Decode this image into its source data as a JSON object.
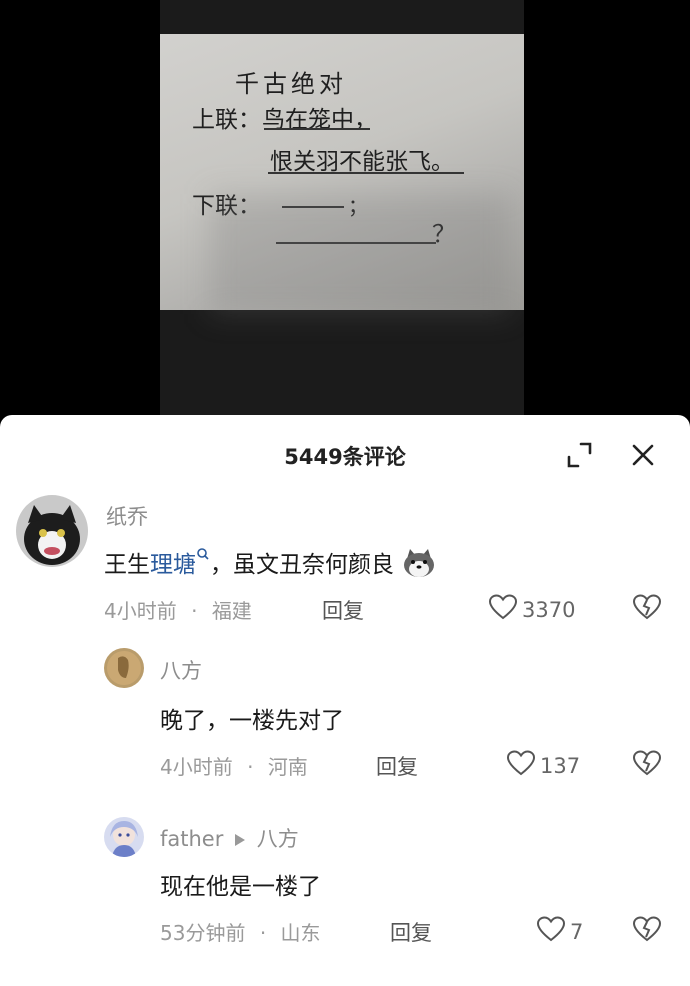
{
  "video": {
    "lines": {
      "title": "千古绝对",
      "upper_label": "上联：",
      "upper_1": "鸟在笼中，",
      "upper_2": "恨关羽不能张飞。",
      "lower_label": "下联：",
      "blank_1_end": "；",
      "blank_2_end": "？"
    }
  },
  "header": {
    "title": "5449条评论",
    "shrink_icon": "shrink-icon",
    "close_icon": "close-icon"
  },
  "comments": [
    {
      "user": "纸乔",
      "text_pre": "王生",
      "link": "理塘",
      "text_post": "，虽文丑奈何颜良",
      "time": "4小时前",
      "location": "福建",
      "reply": "回复",
      "likes": "3370"
    },
    {
      "user": "八方",
      "text": "晚了，一楼先对了",
      "time": "4小时前",
      "location": "河南",
      "reply": "回复",
      "likes": "137"
    },
    {
      "user": "father",
      "reply_to": "八方",
      "text": "现在他是一楼了",
      "time": "53分钟前",
      "location": "山东",
      "reply": "回复",
      "likes": "7"
    }
  ]
}
